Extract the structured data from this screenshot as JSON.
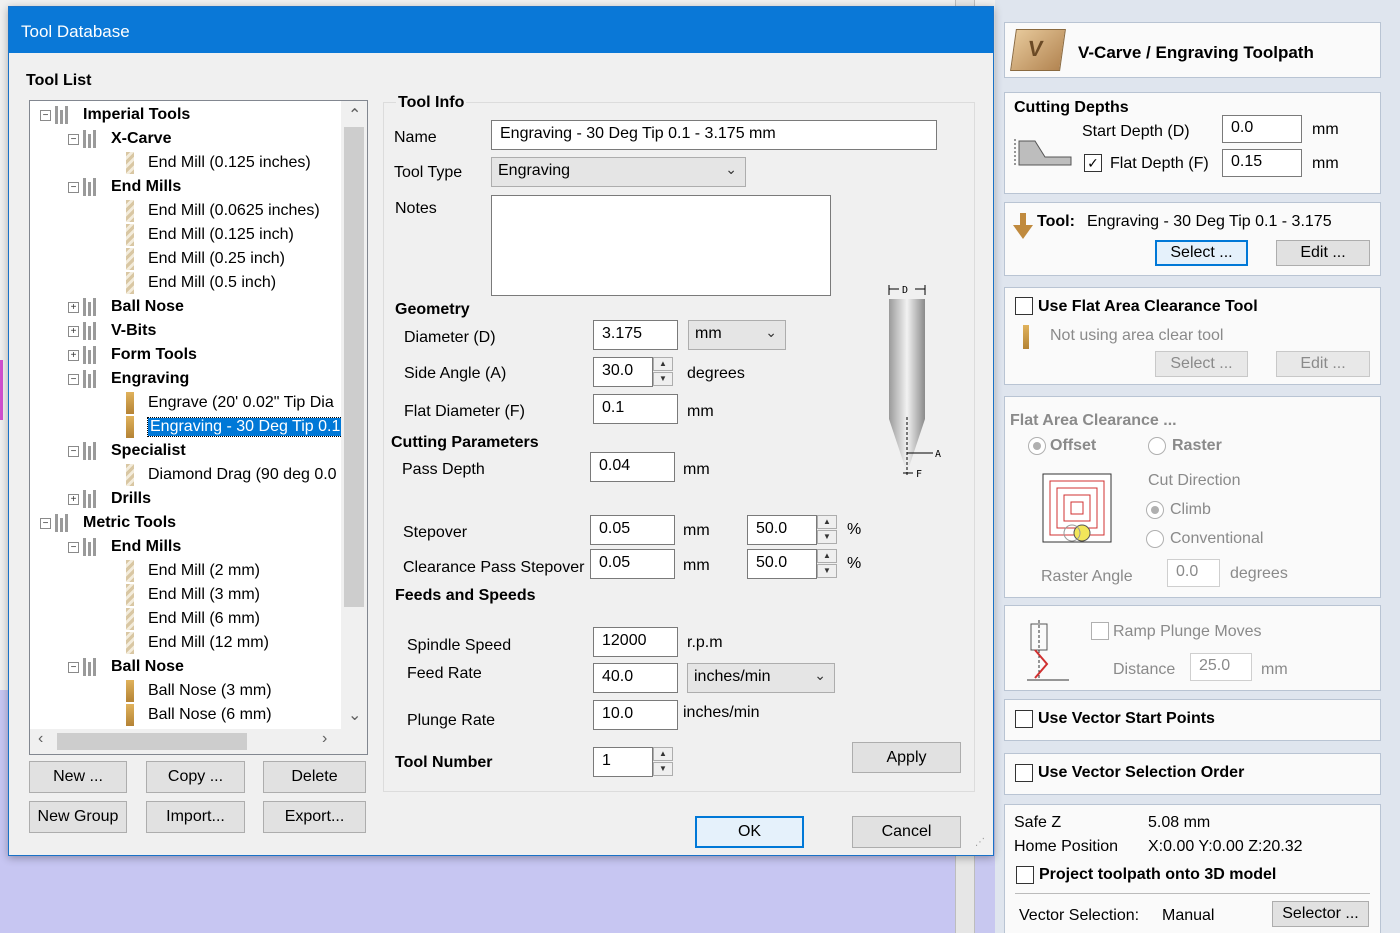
{
  "dialog": {
    "title": "Tool Database",
    "tool_list_label": "Tool List",
    "tree": [
      {
        "label": "Imperial Tools",
        "type": "group",
        "expanded": true
      },
      {
        "label": "X-Carve",
        "type": "group",
        "expanded": true
      },
      {
        "label": "End Mill (0.125 inches)",
        "type": "tool"
      },
      {
        "label": "End Mills",
        "type": "group",
        "expanded": true
      },
      {
        "label": "End Mill (0.0625 inches)",
        "type": "tool"
      },
      {
        "label": "End Mill (0.125 inch)",
        "type": "tool"
      },
      {
        "label": "End Mill (0.25 inch)",
        "type": "tool"
      },
      {
        "label": "End Mill (0.5 inch)",
        "type": "tool"
      },
      {
        "label": "Ball Nose",
        "type": "group",
        "expanded": false
      },
      {
        "label": "V-Bits",
        "type": "group",
        "expanded": false
      },
      {
        "label": "Form Tools",
        "type": "group",
        "expanded": false
      },
      {
        "label": "Engraving",
        "type": "group",
        "expanded": true
      },
      {
        "label": "Engrave (20' 0.02\" Tip Dia",
        "type": "tool"
      },
      {
        "label": "Engraving - 30 Deg Tip 0.1",
        "type": "tool",
        "selected": true
      },
      {
        "label": "Specialist",
        "type": "group",
        "expanded": true
      },
      {
        "label": "Diamond Drag (90 deg 0.0",
        "type": "tool"
      },
      {
        "label": "Drills",
        "type": "group",
        "expanded": false
      },
      {
        "label": "Metric Tools",
        "type": "group",
        "expanded": true
      },
      {
        "label": "End Mills",
        "type": "group",
        "expanded": true
      },
      {
        "label": "End Mill (2 mm)",
        "type": "tool"
      },
      {
        "label": "End Mill (3 mm)",
        "type": "tool"
      },
      {
        "label": "End Mill (6 mm)",
        "type": "tool"
      },
      {
        "label": "End Mill (12 mm)",
        "type": "tool"
      },
      {
        "label": "Ball Nose",
        "type": "group",
        "expanded": true
      },
      {
        "label": "Ball Nose (3 mm)",
        "type": "tool"
      },
      {
        "label": "Ball Nose (6 mm)",
        "type": "tool"
      }
    ],
    "buttons": {
      "new": "New ...",
      "copy": "Copy ...",
      "delete": "Delete",
      "new_group": "New Group",
      "import": "Import...",
      "export": "Export...",
      "ok": "OK",
      "cancel": "Cancel",
      "apply": "Apply"
    },
    "tool_info": {
      "heading": "Tool Info",
      "name_label": "Name",
      "name_value": "Engraving - 30 Deg Tip 0.1 - 3.175 mm",
      "type_label": "Tool Type",
      "type_value": "Engraving",
      "notes_label": "Notes",
      "notes_value": ""
    },
    "geometry": {
      "heading": "Geometry",
      "diameter_label": "Diameter (D)",
      "diameter_value": "3.175",
      "diameter_unit": "mm",
      "side_angle_label": "Side Angle (A)",
      "side_angle_value": "30.0",
      "side_angle_unit": "degrees",
      "flat_diameter_label": "Flat Diameter (F)",
      "flat_diameter_value": "0.1",
      "flat_diameter_unit": "mm",
      "diagram_labels": {
        "d": "D",
        "a": "A",
        "f": "F"
      }
    },
    "cutting": {
      "heading": "Cutting Parameters",
      "pass_depth_label": "Pass Depth",
      "pass_depth_value": "0.04",
      "pass_depth_unit": "mm",
      "stepover_label": "Stepover",
      "stepover_value": "0.05",
      "stepover_unit": "mm",
      "stepover_pct": "50.0",
      "pct_symbol": "%",
      "clear_stepover_label": "Clearance Pass Stepover",
      "clear_stepover_value": "0.05",
      "clear_stepover_unit": "mm",
      "clear_stepover_pct": "50.0"
    },
    "feeds": {
      "heading": "Feeds and Speeds",
      "spindle_label": "Spindle Speed",
      "spindle_value": "12000",
      "spindle_unit": "r.p.m",
      "feed_label": "Feed Rate",
      "feed_value": "40.0",
      "feed_unit": "inches/min",
      "plunge_label": "Plunge Rate",
      "plunge_value": "10.0",
      "plunge_unit": "inches/min"
    },
    "tool_number": {
      "label": "Tool Number",
      "value": "1"
    }
  },
  "panel": {
    "title": "V-Carve / Engraving Toolpath",
    "cutting_depths": {
      "heading": "Cutting Depths",
      "start_label": "Start Depth (D)",
      "start_value": "0.0",
      "start_unit": "mm",
      "flat_label": "Flat Depth (F)",
      "flat_value": "0.15",
      "flat_unit": "mm",
      "flat_checked": "✓"
    },
    "tool": {
      "label": "Tool:",
      "value": "Engraving - 30 Deg Tip 0.1 - 3.175",
      "select": "Select ...",
      "edit": "Edit ..."
    },
    "flat_area_tool": {
      "label": "Use Flat Area Clearance Tool",
      "note": "Not using area clear tool",
      "select": "Select ...",
      "edit": "Edit ..."
    },
    "flat_area_clearance": {
      "heading": "Flat Area Clearance ...",
      "offset": "Offset",
      "raster": "Raster",
      "cut_direction": "Cut Direction",
      "climb": "Climb",
      "conventional": "Conventional",
      "raster_angle_label": "Raster Angle",
      "raster_angle_value": "0.0",
      "raster_angle_unit": "degrees"
    },
    "ramp": {
      "label": "Ramp Plunge Moves",
      "distance_label": "Distance",
      "distance_value": "25.0",
      "distance_unit": "mm"
    },
    "vector_start": "Use Vector Start Points",
    "vector_order": "Use Vector Selection Order",
    "info": {
      "safe_z_label": "Safe Z",
      "safe_z_value": "5.08 mm",
      "home_label": "Home Position",
      "home_value": "X:0.00 Y:0.00 Z:20.32",
      "project_label": "Project toolpath onto 3D model",
      "vector_selection_label": "Vector Selection:",
      "vector_selection_value": "Manual",
      "selector_button": "Selector ..."
    }
  }
}
